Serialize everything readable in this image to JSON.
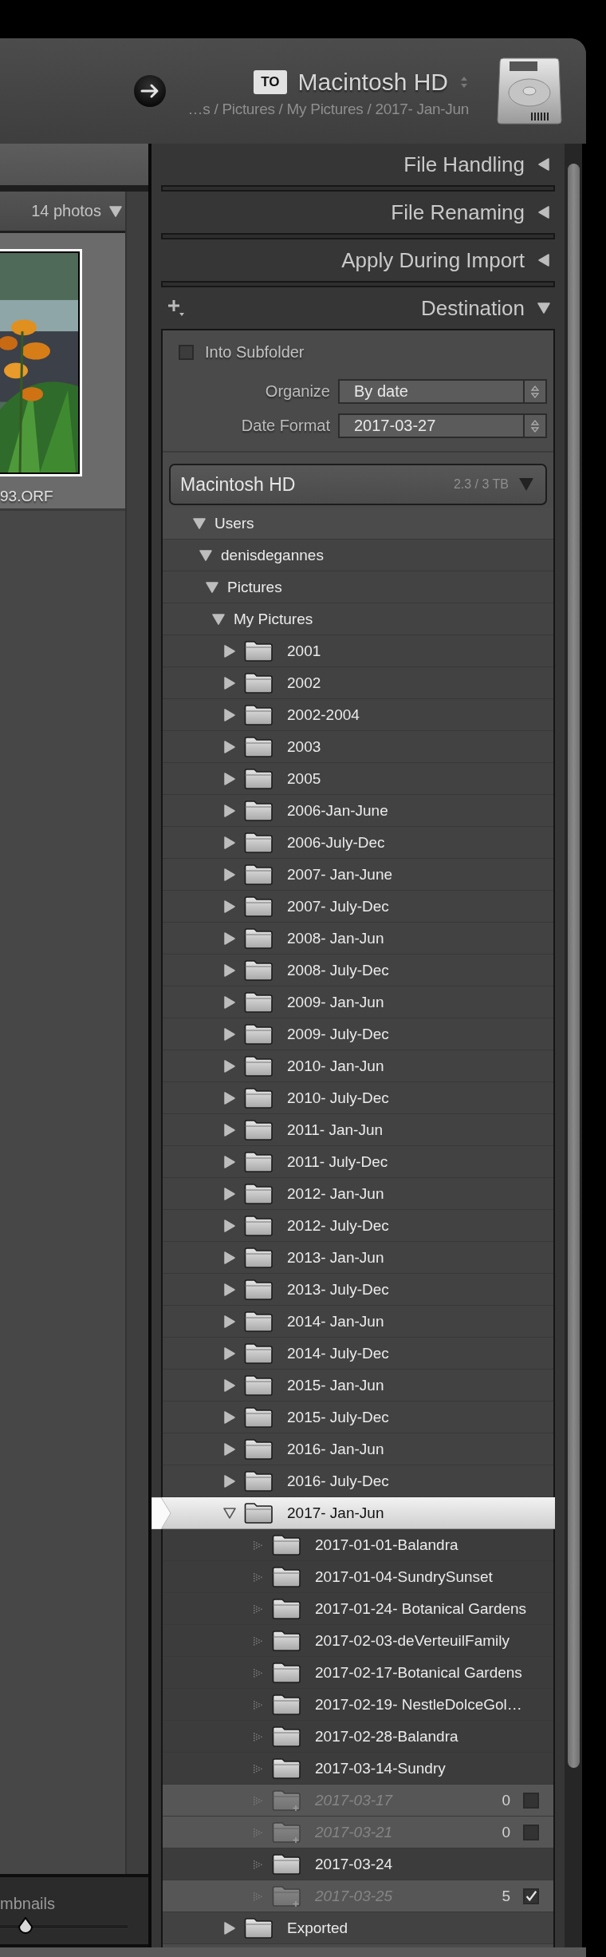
{
  "header": {
    "badge": "TO",
    "volume": "Macintosh HD",
    "path": "…s / Pictures / My Pictures / 2017- Jan-Jun"
  },
  "left_panel": {
    "photo_count": "14 photos",
    "thumbnail": {
      "kind": "picture",
      "filename": "93.ORF"
    },
    "footer_label": "mbnails",
    "thumbnail_size": {
      "level": 0.2
    }
  },
  "sections": [
    {
      "kind": "settings",
      "title": "File Handling",
      "expanded": false
    },
    {
      "kind": "settings",
      "title": "File Renaming",
      "expanded": false
    },
    {
      "kind": "settings",
      "title": "Apply During Import",
      "expanded": false
    },
    {
      "kind": "destination",
      "title": "Destination",
      "expanded": true
    }
  ],
  "destination": {
    "into_subfolder": {
      "label": "Into Subfolder",
      "checked": false
    },
    "fields": [
      {
        "label": "Organize",
        "value": "By date"
      },
      {
        "label": "Date Format",
        "value": "2017-03-27"
      }
    ],
    "volume": {
      "name": "Macintosh HD",
      "usage": "2.3 / 3 TB",
      "expanded": true
    },
    "tree": [
      {
        "kind": "path",
        "label": "Users",
        "expanded": true,
        "selected": false,
        "children": [
          {
            "kind": "path",
            "label": "denisdegannes",
            "expanded": true,
            "selected": false,
            "children": [
              {
                "kind": "path",
                "label": "Pictures",
                "expanded": true,
                "selected": false,
                "children": [
                  {
                    "kind": "path",
                    "label": "My Pictures",
                    "expanded": true,
                    "selected": false,
                    "children": [
                      {
                        "kind": "folder",
                        "label": "2001",
                        "expanded": false,
                        "selected": false
                      },
                      {
                        "kind": "folder",
                        "label": "2002",
                        "expanded": false,
                        "selected": false
                      },
                      {
                        "kind": "folder",
                        "label": "2002-2004",
                        "expanded": false,
                        "selected": false
                      },
                      {
                        "kind": "folder",
                        "label": "2003",
                        "expanded": false,
                        "selected": false
                      },
                      {
                        "kind": "folder",
                        "label": "2005",
                        "expanded": false,
                        "selected": false
                      },
                      {
                        "kind": "folder",
                        "label": "2006-Jan-June",
                        "expanded": false,
                        "selected": false
                      },
                      {
                        "kind": "folder",
                        "label": "2006-July-Dec",
                        "expanded": false,
                        "selected": false
                      },
                      {
                        "kind": "folder",
                        "label": "2007- Jan-June",
                        "expanded": false,
                        "selected": false
                      },
                      {
                        "kind": "folder",
                        "label": "2007- July-Dec",
                        "expanded": false,
                        "selected": false
                      },
                      {
                        "kind": "folder",
                        "label": "2008- Jan-Jun",
                        "expanded": false,
                        "selected": false
                      },
                      {
                        "kind": "folder",
                        "label": "2008- July-Dec",
                        "expanded": false,
                        "selected": false
                      },
                      {
                        "kind": "folder",
                        "label": "2009- Jan-Jun",
                        "expanded": false,
                        "selected": false
                      },
                      {
                        "kind": "folder",
                        "label": "2009- July-Dec",
                        "expanded": false,
                        "selected": false
                      },
                      {
                        "kind": "folder",
                        "label": "2010- Jan-Jun",
                        "expanded": false,
                        "selected": false
                      },
                      {
                        "kind": "folder",
                        "label": "2010- July-Dec",
                        "expanded": false,
                        "selected": false
                      },
                      {
                        "kind": "folder",
                        "label": "2011- Jan-Jun",
                        "expanded": false,
                        "selected": false
                      },
                      {
                        "kind": "folder",
                        "label": "2011- July-Dec",
                        "expanded": false,
                        "selected": false
                      },
                      {
                        "kind": "folder",
                        "label": "2012- Jan-Jun",
                        "expanded": false,
                        "selected": false
                      },
                      {
                        "kind": "folder",
                        "label": "2012- July-Dec",
                        "expanded": false,
                        "selected": false
                      },
                      {
                        "kind": "folder",
                        "label": "2013- Jan-Jun",
                        "expanded": false,
                        "selected": false
                      },
                      {
                        "kind": "folder",
                        "label": "2013- July-Dec",
                        "expanded": false,
                        "selected": false
                      },
                      {
                        "kind": "folder",
                        "label": "2014- Jan-Jun",
                        "expanded": false,
                        "selected": false
                      },
                      {
                        "kind": "folder",
                        "label": "2014- July-Dec",
                        "expanded": false,
                        "selected": false
                      },
                      {
                        "kind": "folder",
                        "label": "2015- Jan-Jun",
                        "expanded": false,
                        "selected": false
                      },
                      {
                        "kind": "folder",
                        "label": "2015- July-Dec",
                        "expanded": false,
                        "selected": false
                      },
                      {
                        "kind": "folder",
                        "label": "2016- Jan-Jun",
                        "expanded": false,
                        "selected": false
                      },
                      {
                        "kind": "folder",
                        "label": "2016- July-Dec",
                        "expanded": false,
                        "selected": false
                      },
                      {
                        "kind": "folder",
                        "label": "2017- Jan-Jun",
                        "expanded": true,
                        "selected": true,
                        "children": [
                          {
                            "kind": "leaf",
                            "label": "2017-01-01-Balandra",
                            "selected": false
                          },
                          {
                            "kind": "leaf",
                            "label": "2017-01-04-SundrySunset",
                            "selected": false
                          },
                          {
                            "kind": "leaf",
                            "label": "2017-01-24- Botanical Gardens",
                            "selected": false
                          },
                          {
                            "kind": "leaf",
                            "label": "2017-02-03-deVerteuilFamily",
                            "selected": false
                          },
                          {
                            "kind": "leaf",
                            "label": "2017-02-17-Botanical Gardens",
                            "selected": false
                          },
                          {
                            "kind": "leaf",
                            "label": "2017-02-19- NestleDolceGol…",
                            "selected": false
                          },
                          {
                            "kind": "leaf",
                            "label": "2017-02-28-Balandra",
                            "selected": false
                          },
                          {
                            "kind": "leaf",
                            "label": "2017-03-14-Sundry",
                            "selected": false
                          },
                          {
                            "kind": "new_leaf",
                            "label": "2017-03-17",
                            "selected": false,
                            "count": "0",
                            "checked": false
                          },
                          {
                            "kind": "new_leaf",
                            "label": "2017-03-21",
                            "selected": false,
                            "count": "0",
                            "checked": false
                          },
                          {
                            "kind": "leaf",
                            "label": "2017-03-24",
                            "selected": false
                          },
                          {
                            "kind": "new_leaf",
                            "label": "2017-03-25",
                            "selected": false,
                            "count": "5",
                            "checked": true
                          }
                        ]
                      },
                      {
                        "kind": "folder",
                        "label": "Exported",
                        "expanded": false,
                        "selected": false
                      }
                    ]
                  }
                ]
              }
            ]
          }
        ]
      }
    ]
  }
}
